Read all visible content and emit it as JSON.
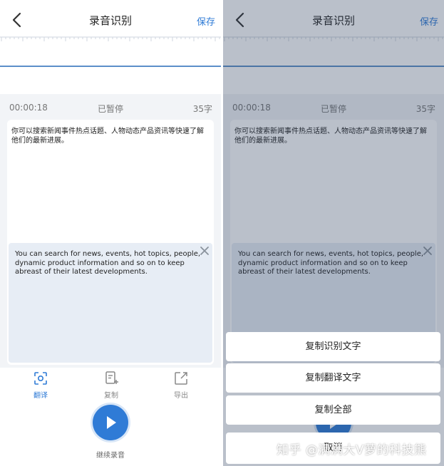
{
  "header": {
    "title": "录音识别",
    "save_label": "保存"
  },
  "status": {
    "time": "00:00:18",
    "state": "已暂停",
    "char_count": "35字"
  },
  "recognized_text": "你可以搜索新闻事件热点话题、人物动态产品资讯等快速了解他们的最新进展。",
  "translation_text": "You can search for news, events, hot topics, people, dynamic product information and so on to keep abreast of their latest developments.",
  "toolbar": {
    "items": [
      {
        "label": "翻译",
        "icon": "translate-icon",
        "active": true
      },
      {
        "label": "复制",
        "icon": "copy-icon",
        "active": false
      },
      {
        "label": "导出",
        "icon": "export-icon",
        "active": false
      }
    ]
  },
  "record": {
    "label": "继续录音"
  },
  "action_sheet": {
    "copy_recognized": "复制识别文字",
    "copy_translation": "复制翻译文字",
    "copy_all": "复制全部",
    "cancel": "取消"
  },
  "watermark": "知乎 @满满大V萝的科技熊",
  "colors": {
    "accent": "#2f7bd6",
    "background": "#f2f4f7",
    "translation_bg": "#e7edf5"
  }
}
